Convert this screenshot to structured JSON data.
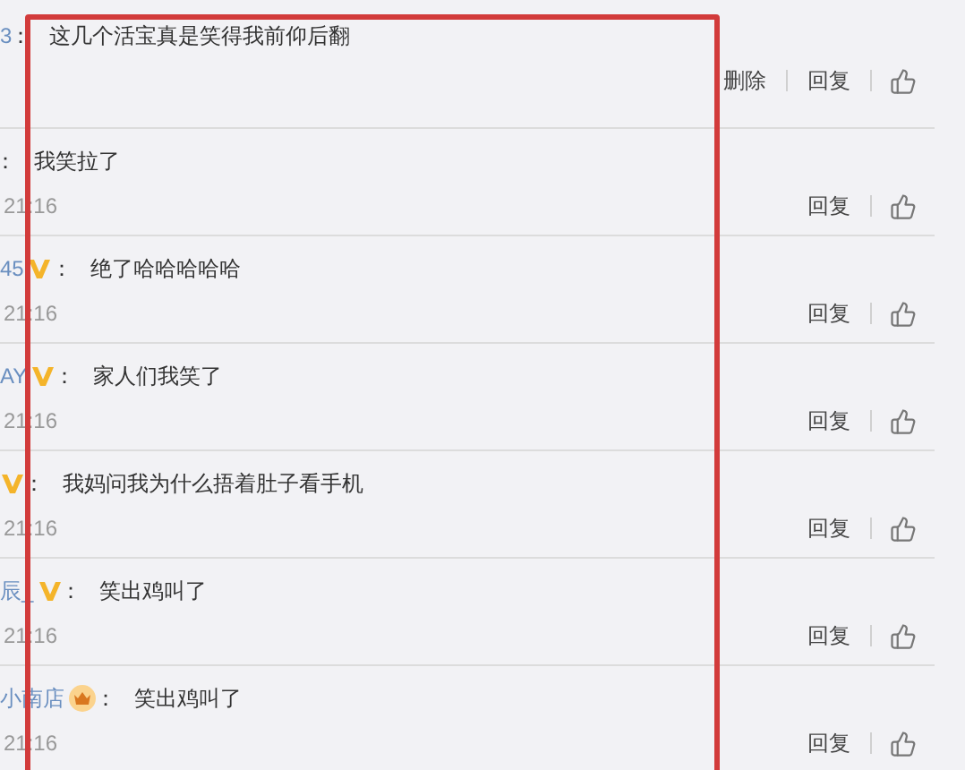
{
  "comments": [
    {
      "user": "3",
      "colon": "：",
      "text": "这几个活宝真是笑得我前仰后翻",
      "actions": [
        "删除",
        "回复"
      ]
    },
    {
      "colon": "：",
      "text": "我笑拉了",
      "time": "21:16",
      "actions": [
        "回复"
      ]
    },
    {
      "user": "45",
      "badge": {
        "kind": "v"
      },
      "colon": "：",
      "text": "绝了哈哈哈哈哈",
      "time": "21:16",
      "actions": [
        "回复"
      ]
    },
    {
      "user": "AY",
      "badge": {
        "kind": "v"
      },
      "colon": "：",
      "text": "家人们我笑了",
      "time": "21:16",
      "actions": [
        "回复"
      ]
    },
    {
      "badge": {
        "kind": "v"
      },
      "colon": "：",
      "text": "我妈问我为什么捂着肚子看手机",
      "time": "21:16",
      "actions": [
        "回复"
      ]
    },
    {
      "user": "辰_",
      "badge": {
        "kind": "v"
      },
      "colon": "：",
      "text": "笑出鸡叫了",
      "time": "21:16",
      "actions": [
        "回复"
      ]
    },
    {
      "user": "小南店",
      "badge": {
        "kind": "crown"
      },
      "colon": "：",
      "text": "笑出鸡叫了",
      "time": "21:16",
      "actions": [
        "回复"
      ]
    }
  ]
}
